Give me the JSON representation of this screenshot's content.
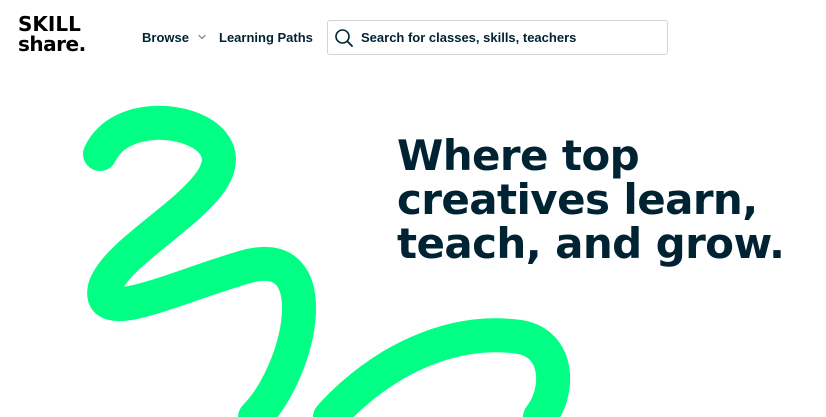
{
  "header": {
    "logo": {
      "line1": "SKILL",
      "line2": "share."
    },
    "nav": {
      "browse_label": "Browse",
      "learning_paths_label": "Learning Paths"
    },
    "search": {
      "placeholder": "Search for classes, skills, teachers",
      "value": ""
    }
  },
  "hero": {
    "headline_lines": [
      "Where top",
      "creatives learn,",
      "teach, and grow."
    ]
  },
  "colors": {
    "brand_green": "#00ff84",
    "text_navy": "#002333",
    "search_border": "#d3d3d6"
  },
  "icons": {
    "search": "search-icon",
    "browse_dropdown": "chevron-down-icon"
  }
}
